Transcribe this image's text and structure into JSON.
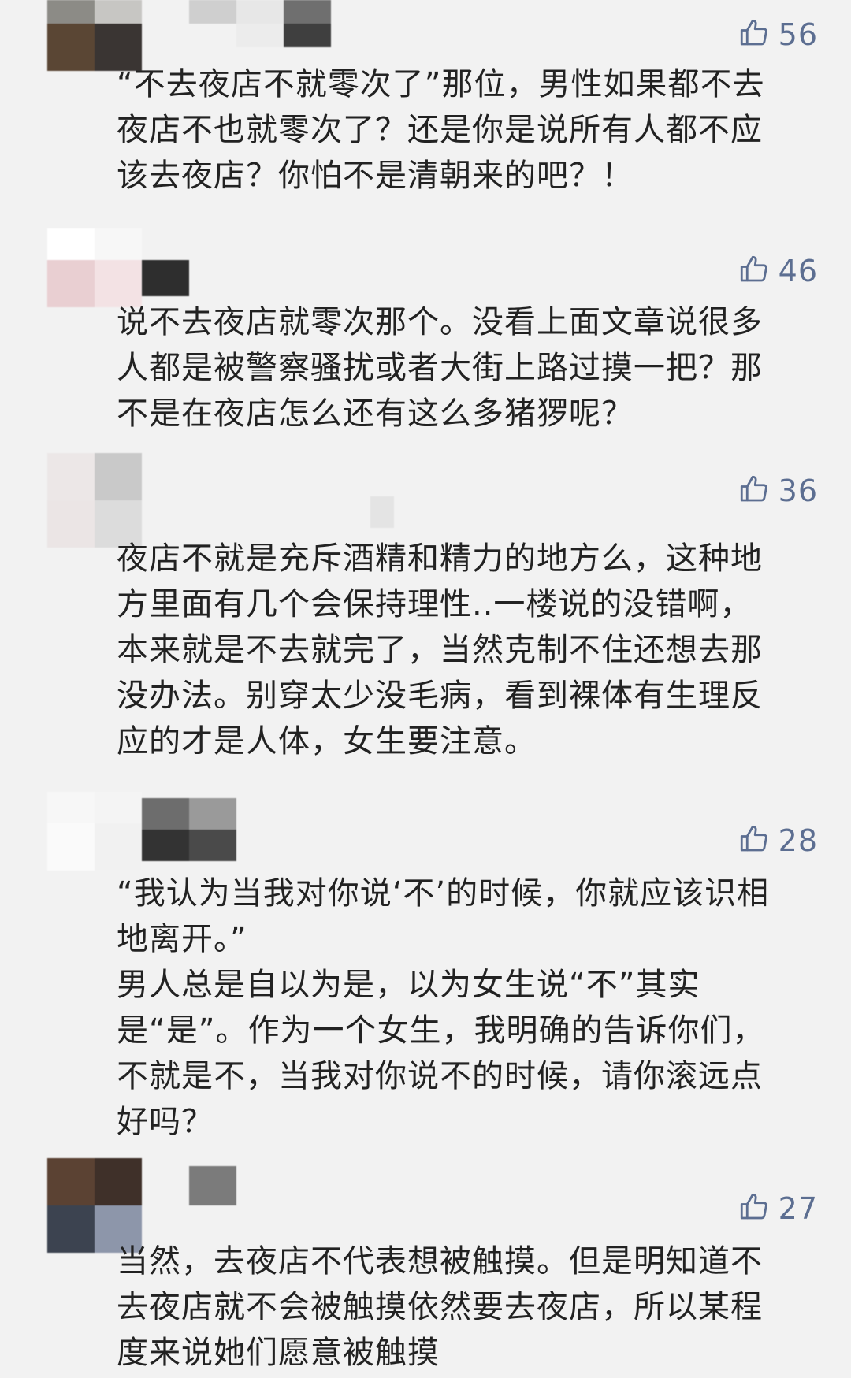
{
  "colors": {
    "background": "#f2f2f2",
    "like_color": "#5c6e91",
    "text_color": "#222222"
  },
  "comments": [
    {
      "likes": "56",
      "text": "“不去夜店不就零次了”那位，男性如果都不去\n夜店不也就零次了？还是你是说所有人都不应\n该去夜店？你怕不是清朝来的吧？！",
      "icon": "thumbs-up-icon"
    },
    {
      "likes": "46",
      "text": "说不去夜店就零次那个。没看上面文章说很多\n人都是被警察骚扰或者大街上路过摸一把？那\n不是在夜店怎么还有这么多猪猡呢？",
      "icon": "thumbs-up-icon"
    },
    {
      "likes": "36",
      "text": "夜店不就是充斥酒精和精力的地方么，这种地\n方里面有几个会保持理性..一楼说的没错啊，\n本来就是不去就完了，当然克制不住还想去那\n没办法。别穿太少没毛病，看到裸体有生理反\n应的才是人体，女生要注意。",
      "icon": "thumbs-up-icon"
    },
    {
      "likes": "28",
      "text": "“我认为当我对你说‘不’的时候，你就应该识相\n地离开。”\n男人总是自以为是，以为女生说“不”其实\n是“是”。作为一个女生，我明确的告诉你们，\n不就是不，当我对你说不的时候，请你滚远点\n好吗？",
      "icon": "thumbs-up-icon"
    },
    {
      "likes": "27",
      "text": "当然，去夜店不代表想被触摸。但是明知道不\n去夜店就不会被触摸依然要去夜店，所以某程\n度来说她们愿意被触摸",
      "icon": "thumbs-up-icon"
    }
  ]
}
